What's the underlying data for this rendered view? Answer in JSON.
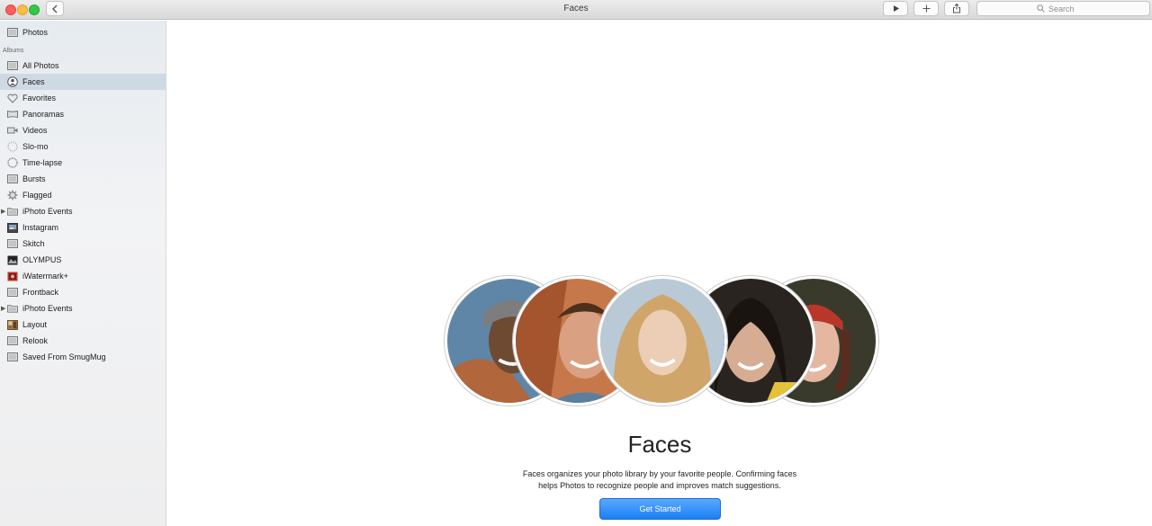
{
  "window": {
    "title": "Faces",
    "back_symbol": "‹",
    "toolbar": {
      "play_symbol": "▶",
      "add_symbol": "+",
      "share_symbol": "⇪"
    },
    "search": {
      "placeholder": "Search"
    }
  },
  "sidebar": {
    "top_item": {
      "label": "Photos",
      "icon": "photos-icon"
    },
    "section_header": "Albums",
    "items": [
      {
        "label": "All Photos",
        "icon": "album-icon",
        "selected": false
      },
      {
        "label": "Faces",
        "icon": "person-icon",
        "selected": true
      },
      {
        "label": "Favorites",
        "icon": "heart-icon",
        "selected": false
      },
      {
        "label": "Panoramas",
        "icon": "panorama-icon",
        "selected": false
      },
      {
        "label": "Videos",
        "icon": "video-icon",
        "selected": false
      },
      {
        "label": "Slo-mo",
        "icon": "slomo-icon",
        "selected": false
      },
      {
        "label": "Time-lapse",
        "icon": "timelapse-icon",
        "selected": false
      },
      {
        "label": "Bursts",
        "icon": "burst-icon",
        "selected": false
      },
      {
        "label": "Flagged",
        "icon": "gear-icon",
        "selected": false
      },
      {
        "label": "iPhoto Events",
        "icon": "folder-icon",
        "selected": false,
        "disclosure": "▶"
      },
      {
        "label": "Instagram",
        "icon": "instagram-album-icon",
        "selected": false
      },
      {
        "label": "Skitch",
        "icon": "album-icon",
        "selected": false
      },
      {
        "label": "OLYMPUS",
        "icon": "olympus-album-icon",
        "selected": false
      },
      {
        "label": "iWatermark+",
        "icon": "iwatermark-album-icon",
        "selected": false
      },
      {
        "label": "Frontback",
        "icon": "album-icon",
        "selected": false
      },
      {
        "label": "iPhoto Events",
        "icon": "folder-icon",
        "selected": false,
        "disclosure": "▶"
      },
      {
        "label": "Layout",
        "icon": "layout-album-icon",
        "selected": false
      },
      {
        "label": "Relook",
        "icon": "album-icon",
        "selected": false
      },
      {
        "label": "Saved From SmugMug",
        "icon": "album-icon",
        "selected": false
      }
    ]
  },
  "main": {
    "title": "Faces",
    "description_line1": "Faces organizes your photo library by your favorite people. Confirming faces",
    "description_line2": "helps Photos to recognize people and improves match suggestions.",
    "button_label": "Get Started",
    "colors": {
      "accent": "#1b7ff5"
    }
  }
}
